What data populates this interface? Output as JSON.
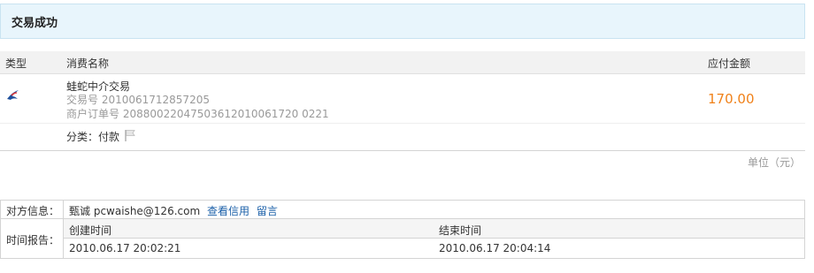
{
  "header": {
    "title": "交易成功"
  },
  "order": {
    "columns": {
      "type": "类型",
      "name": "消费名称",
      "amount": "应付金额"
    },
    "item": {
      "icon": "alipay-swallow-icon",
      "name": "蛙蛇中介交易",
      "trade_no": "交易号 2010061712857205",
      "merchant_order_no": "商户订单号 20880022047503612010061720 0221",
      "amount": "170.00",
      "category": "分类：付款",
      "flag_icon": "flag-icon"
    },
    "unit": "单位（元）"
  },
  "info": {
    "party_label": "对方信息：",
    "party_name": "甄诚",
    "party_email": "pcwaishe@126.com",
    "check_credit_link": "查看信用",
    "message_link": "留言",
    "time_label": "时间报告：",
    "created_label": "创建时间",
    "ended_label": "结束时间",
    "created_value": "2010.06.17 20:02:21",
    "ended_value": "2010.06.17 20:04:14"
  },
  "colors": {
    "amount": "#f08119",
    "link": "#1a5fa8",
    "title_bg": "#e8f5fc"
  }
}
